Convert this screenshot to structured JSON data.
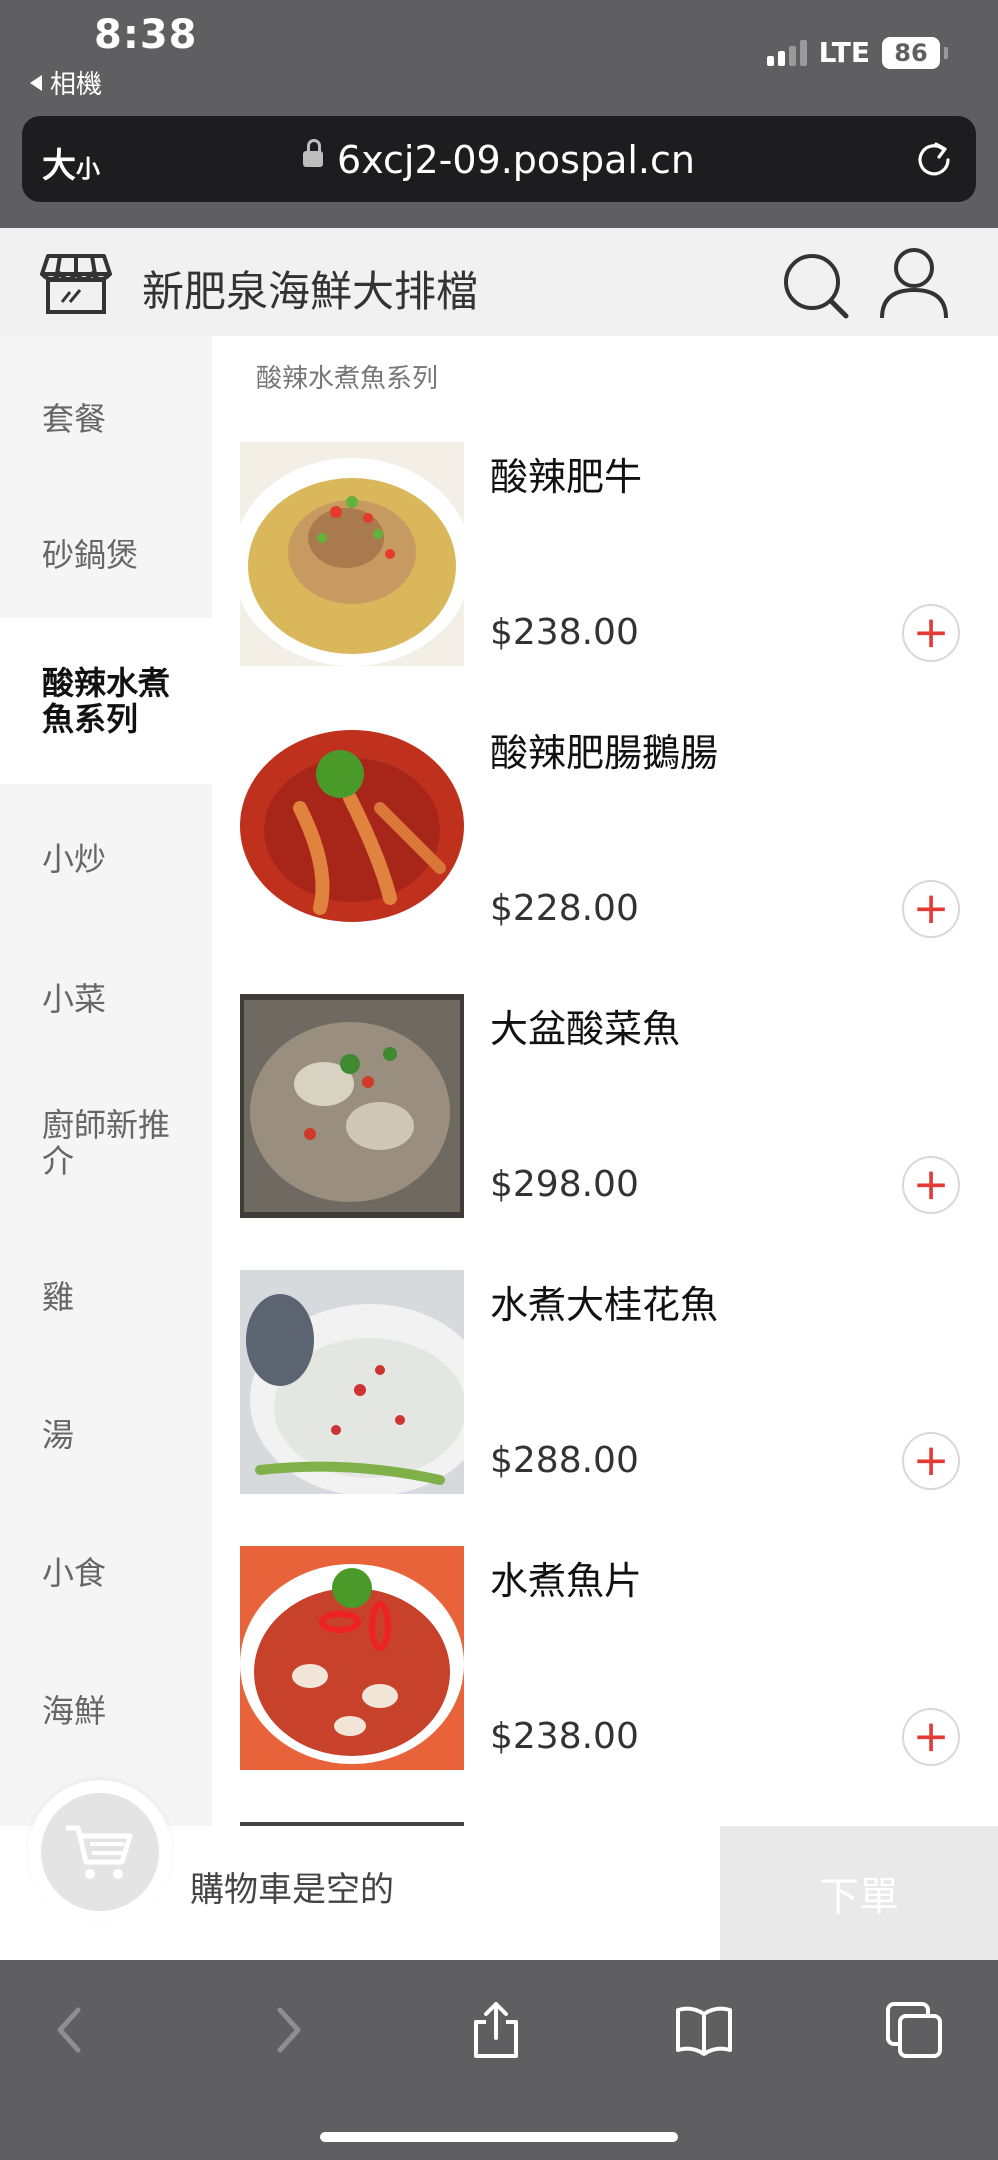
{
  "status_bar": {
    "time": "8:38",
    "back_app": "相機",
    "network": "LTE",
    "battery": "86"
  },
  "address_bar": {
    "text_size_big": "大",
    "text_size_small": "小",
    "url": "6xcj2-09.pospal.cn"
  },
  "header": {
    "shop_name": "新肥泉海鮮大排檔"
  },
  "sidebar": {
    "categories": [
      {
        "label": "套餐"
      },
      {
        "label": "砂鍋煲"
      },
      {
        "label": "酸辣水煮魚系列",
        "active": true
      },
      {
        "label": "小炒"
      },
      {
        "label": "小菜"
      },
      {
        "label": "廚師新推介"
      },
      {
        "label": "雞"
      },
      {
        "label": "湯"
      },
      {
        "label": "小食"
      },
      {
        "label": "海鮮"
      }
    ]
  },
  "main": {
    "section_title": "酸辣水煮魚系列",
    "products": [
      {
        "name": "酸辣肥牛",
        "price": "$238.00",
        "add_icon": "+"
      },
      {
        "name": "酸辣肥腸鵝腸",
        "price": "$228.00",
        "add_icon": "+"
      },
      {
        "name": "大盆酸菜魚",
        "price": "$298.00",
        "add_icon": "+"
      },
      {
        "name": "水煮大桂花魚",
        "price": "$288.00",
        "add_icon": "+"
      },
      {
        "name": "水煮魚片",
        "price": "$238.00",
        "add_icon": "+"
      }
    ]
  },
  "cart": {
    "empty_text": "購物車是空的",
    "checkout_label": "下單"
  },
  "colors": {
    "accent_red": "#e53935",
    "sidebar_bg": "#f5f5f6",
    "browser_chrome": "#5f5f61"
  }
}
